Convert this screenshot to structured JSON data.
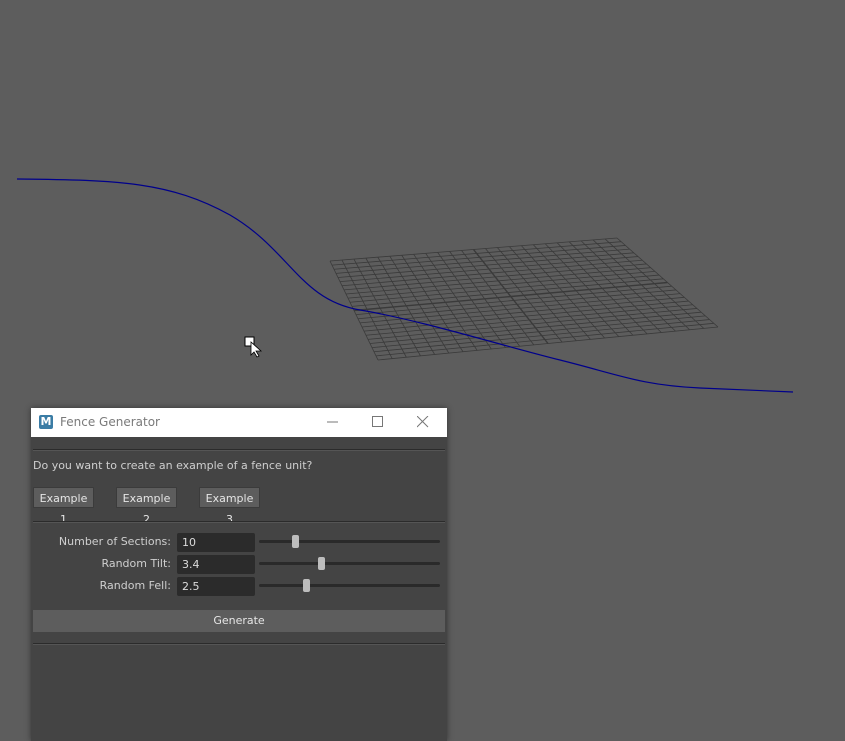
{
  "window": {
    "title": "Fence Generator",
    "app_icon_letter": "M"
  },
  "prompt": "Do you want to create an example of a fence unit?",
  "examples": [
    {
      "label": "Example 1"
    },
    {
      "label": "Example 2"
    },
    {
      "label": "Example 3"
    }
  ],
  "params": [
    {
      "label": "Number of Sections:",
      "value": "10",
      "slider_fraction": 0.2
    },
    {
      "label": "Random Tilt:",
      "value": "3.4",
      "slider_fraction": 0.34
    },
    {
      "label": "Random Fell:",
      "value": "2.5",
      "slider_fraction": 0.26
    }
  ],
  "generate_label": "Generate",
  "colors": {
    "viewport_bg": "#5d5d5d",
    "curve": "#00008b",
    "grid": "#3a3a3a",
    "panel_bg": "#444444",
    "titlebar_bg": "#ffffff",
    "app_icon": "#3a7ca5"
  },
  "icons": {
    "cursor": "select-cursor-icon",
    "minimize": "minimize-icon",
    "maximize": "maximize-icon",
    "close": "close-icon"
  }
}
